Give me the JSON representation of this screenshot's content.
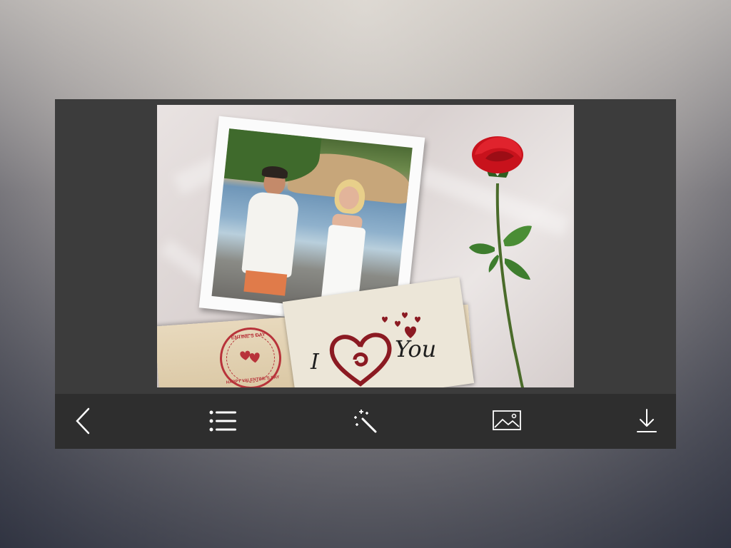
{
  "canvas": {
    "stamp": {
      "top_text": "ENTINE'S DAY",
      "bottom_text": "HAPPY VALENTINE'S DAY"
    },
    "card": {
      "i_text": "I",
      "you_text": "You"
    }
  },
  "toolbar": {
    "buttons": [
      {
        "name": "back-button",
        "icon": "chevron-left-icon"
      },
      {
        "name": "menu-list-button",
        "icon": "list-icon"
      },
      {
        "name": "magic-wand-button",
        "icon": "magic-wand-icon"
      },
      {
        "name": "gallery-button",
        "icon": "image-icon"
      },
      {
        "name": "download-button",
        "icon": "download-icon"
      }
    ]
  },
  "colors": {
    "panel": "#3c3c3c",
    "toolbar": "#2e2e2e",
    "icon": "#ffffff",
    "heart": "#8b1a22",
    "rose": "#c8121c"
  }
}
